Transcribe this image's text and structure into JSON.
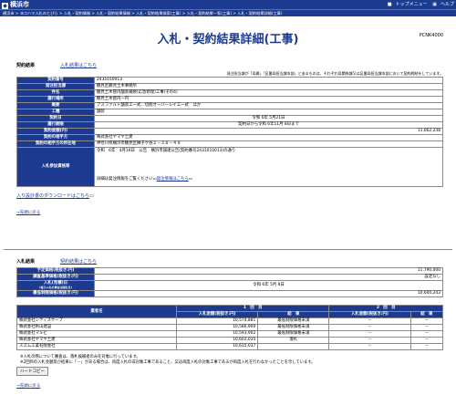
{
  "header": {
    "logo": "横浜市",
    "toplink": "トップメニュー",
    "help": "ヘルプ"
  },
  "breadcrumb": "横浜市 > ヨコハマ入札のとびら > 入札・契約情報 > 入札・契約結果情報 > 入札・契約結果検索(工事) > 入札・契約結果一覧(工事) > 入札・契約結果詳細(工事)",
  "title": "入札・契約結果詳細(工事)",
  "page_code": "PCNK4000",
  "contract": {
    "heading": "契約結果",
    "link": "入札結果はこちら",
    "note": "発注担当課が「局属」「区番局担当課本部」とあるものは、それぞれ局関係課又は区番局担当課本部において契約締結をしています。",
    "rows": [
      {
        "label": "契約番号",
        "value": "2431010013"
      },
      {
        "label": "発注担当課",
        "value": "鶴見区鶴見土木事務所"
      },
      {
        "label": "件名",
        "value": "鶴見土木管内舗装補修(応急修理)工事(その4)"
      },
      {
        "label": "履行場所",
        "value": "鶴見土木管内一円"
      },
      {
        "label": "概要",
        "value": "アスファルト舗装工一式、切削オーバーレイ工一式　ほか"
      },
      {
        "label": "工種",
        "value": "舗装"
      },
      {
        "label": "契約日",
        "value": "令和 6年 5月21日"
      },
      {
        "label": "履行期限",
        "value": "契約日から令和 6年11月 8日まで"
      },
      {
        "label": "契約金額(円)",
        "value": "11,662,238"
      },
      {
        "label": "契約の相手方",
        "value": "株式会社ヤマヤ土建"
      },
      {
        "label": "契約の相手方の所在地",
        "value": "神奈川県横浜市鶴見区獅子ケ谷２－３８－４９"
      }
    ],
    "participants_label": "入札参加資格等",
    "participants_line": "令和　6年　4月16日　公告　横浜市調達公告(契約番号2431010013)の通り",
    "participants_detail": "詳細は発注情報をご覧ください",
    "participants_link": "発注情報はこちら",
    "download_link": "入り設計書のダウンロードはこちら",
    "backtop": "→先頭に戻る"
  },
  "bid": {
    "heading": "入札結果",
    "link": "契約結果はこちら",
    "rows": [
      {
        "label": "予定価格(税抜き:円)",
        "value": "11,790,000"
      },
      {
        "label": "調査基準価格(税抜き:円)",
        "value": "設定なし"
      },
      {
        "label": "入札(見積)日",
        "sublabel": "(電子入札の場合は開札日)",
        "value": "令和 6年 5月 8日"
      },
      {
        "label": "最低制限価格(税抜き:円)",
        "value": "10,600,243"
      }
    ],
    "table_headers": {
      "company": "業者名",
      "round1": "1　回　目",
      "round2": "2　回　目",
      "amount": "入札金額(税抜き:円)",
      "result": "結　果",
      "amount2": "入札金額(税抜き:円)",
      "result2": "結　果"
    },
    "bidders": [
      {
        "name": "株式会社シティスケープ",
        "amount1": "10,574,881",
        "result1": "最低制限価格未満",
        "amount2": "－",
        "result2": "－"
      },
      {
        "name": "株式会社秋山建設",
        "amount1": "10,586,900",
        "result1": "最低制限価格未満",
        "amount2": "－",
        "result2": "－"
      },
      {
        "name": "株式会社マルビ",
        "amount1": "10,593,902",
        "result1": "最低制限価格未満",
        "amount2": "－",
        "result2": "－"
      },
      {
        "name": "株式会社ヤマヤ土建",
        "amount1": "10,602,035",
        "result1": "落札",
        "amount2": "－",
        "result2": "－"
      },
      {
        "name": "スズム工業有限会社",
        "amount1": "10,615,037",
        "result1": "",
        "amount2": "－",
        "result2": "－"
      }
    ],
    "notes": [
      "※入札の際について審査は、落札候補者のみを対象に行っています。",
      "※2回目の入札金額及び結果に「－」がある場合は、再度入札の非対象工事であること、又は再度入札の対象工事であるが再度入札を行わなかったことを示しています。"
    ],
    "hardcopy_button": "ハードコピー",
    "backtop": "→先頭に戻る"
  }
}
